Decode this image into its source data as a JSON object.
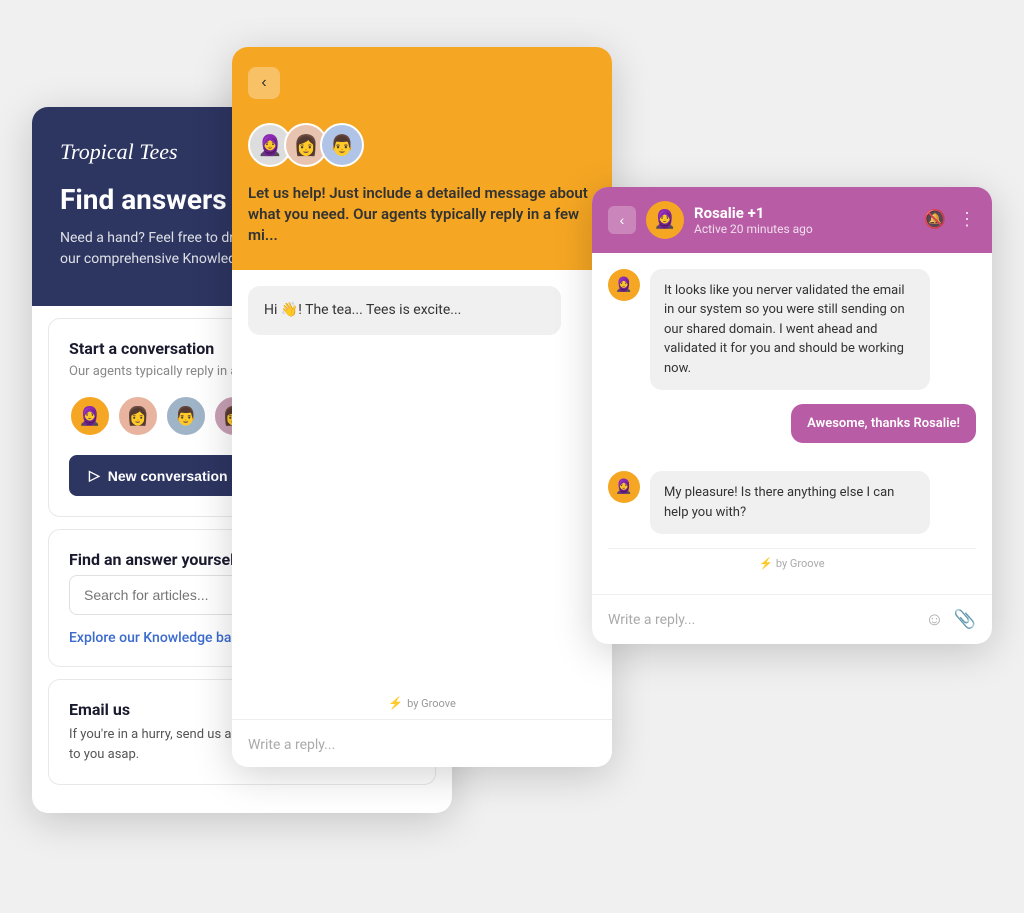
{
  "cards": {
    "left": {
      "brand": "Tropical Tees",
      "header_title": "Find answers you need 👋",
      "header_subtitle": "Need a hand? Feel free to drop us a message or search our comprehensive Knowledge base.",
      "start_conversation": {
        "title": "Start a conversation",
        "subtitle": "Our agents typically reply in a few minutes.",
        "new_btn_label": "New conversation"
      },
      "find_answer": {
        "title": "Find an answer yourself",
        "search_placeholder": "Search for articles...",
        "knowledge_link": "Explore our Knowledge base"
      },
      "email": {
        "title": "Email us",
        "text": "If you're in a hurry, send us a message and we will get back to you asap."
      }
    },
    "middle": {
      "header_text": "Let us help! Just include a detailed message about what you need. Our agents typically reply in a few mi...",
      "chat_bubble": "Hi 👋! The tea... Tees is excite...",
      "reply_placeholder": "Write a reply...",
      "groove_badge": "by Groove"
    },
    "right": {
      "agent_name": "Rosalie +1",
      "agent_status": "Active 20 minutes ago",
      "message1": "It looks like you nerver validated the email in our system so you were still sending on our shared domain. I went ahead and validated it for you and should be working now.",
      "message2": "Awesome, thanks Rosalie!",
      "message3": "My pleasure! Is there anything else I can help you with?",
      "reply_placeholder": "Write a reply...",
      "groove_badge": "by Groove"
    }
  },
  "icons": {
    "back": "‹",
    "send": "›",
    "bell_off": "🔕",
    "more": "⋮",
    "lightning": "⚡",
    "emoji": "☺",
    "attach": "📎",
    "new_conv_icon": "⇒"
  }
}
